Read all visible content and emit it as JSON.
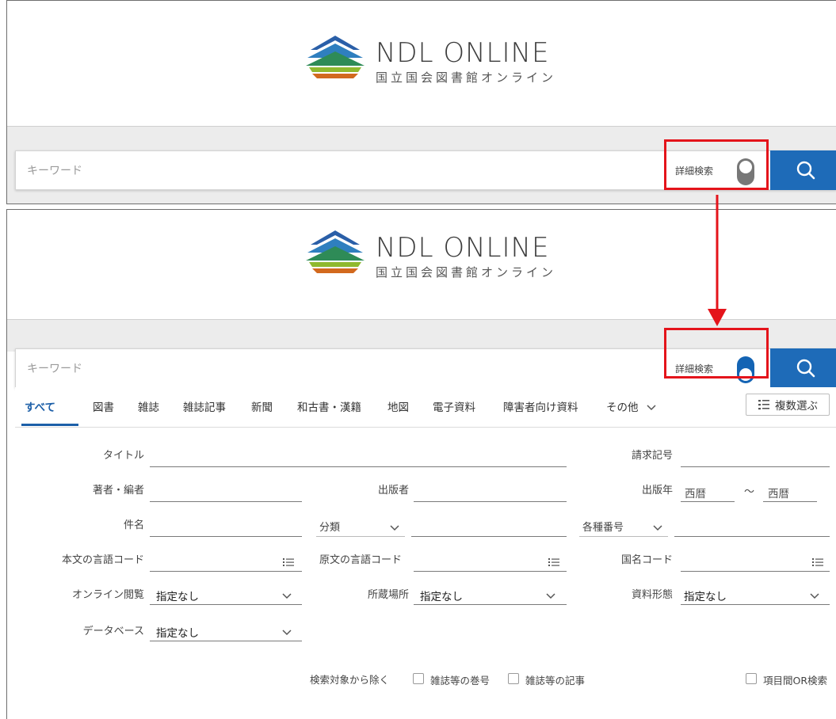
{
  "logo": {
    "title": "NDL ONLINE",
    "subtitle": "国立国会図書館オンライン"
  },
  "search": {
    "placeholder": "キーワード",
    "advanced_toggle_label": "詳細検索"
  },
  "tabs": [
    {
      "label": "すべて",
      "active": true
    },
    {
      "label": "図書"
    },
    {
      "label": "雑誌"
    },
    {
      "label": "雑誌記事"
    },
    {
      "label": "新聞"
    },
    {
      "label": "和古書・漢籍"
    },
    {
      "label": "地図"
    },
    {
      "label": "電子資料"
    },
    {
      "label": "障害者向け資料"
    },
    {
      "label": "その他"
    }
  ],
  "multi_select_label": "複数選ぶ",
  "form": {
    "title_label": "タイトル",
    "call_number_label": "請求記号",
    "author_label": "著者・編者",
    "publisher_label": "出版者",
    "pub_year_label": "出版年",
    "year_from_placeholder": "西暦",
    "year_tilde": "〜",
    "year_to_placeholder": "西暦",
    "subject_label": "件名",
    "classification_label": "分類",
    "various_numbers_label": "各種番号",
    "text_lang_label": "本文の言語コード",
    "orig_lang_label": "原文の言語コード",
    "country_code_label": "国名コード",
    "online_view_label": "オンライン閲覧",
    "online_view_value": "指定なし",
    "location_label": "所蔵場所",
    "location_value": "指定なし",
    "material_type_label": "資料形態",
    "material_type_value": "指定なし",
    "database_label": "データベース",
    "database_value": "指定なし",
    "exclude_label": "検索対象から除く",
    "exclude_option1": "雑誌等の巻号",
    "exclude_option2": "雑誌等の記事",
    "or_search_label": "項目間OR検索"
  },
  "colors": {
    "accent": "#1e6bb8",
    "annotation": "#e4141b"
  }
}
